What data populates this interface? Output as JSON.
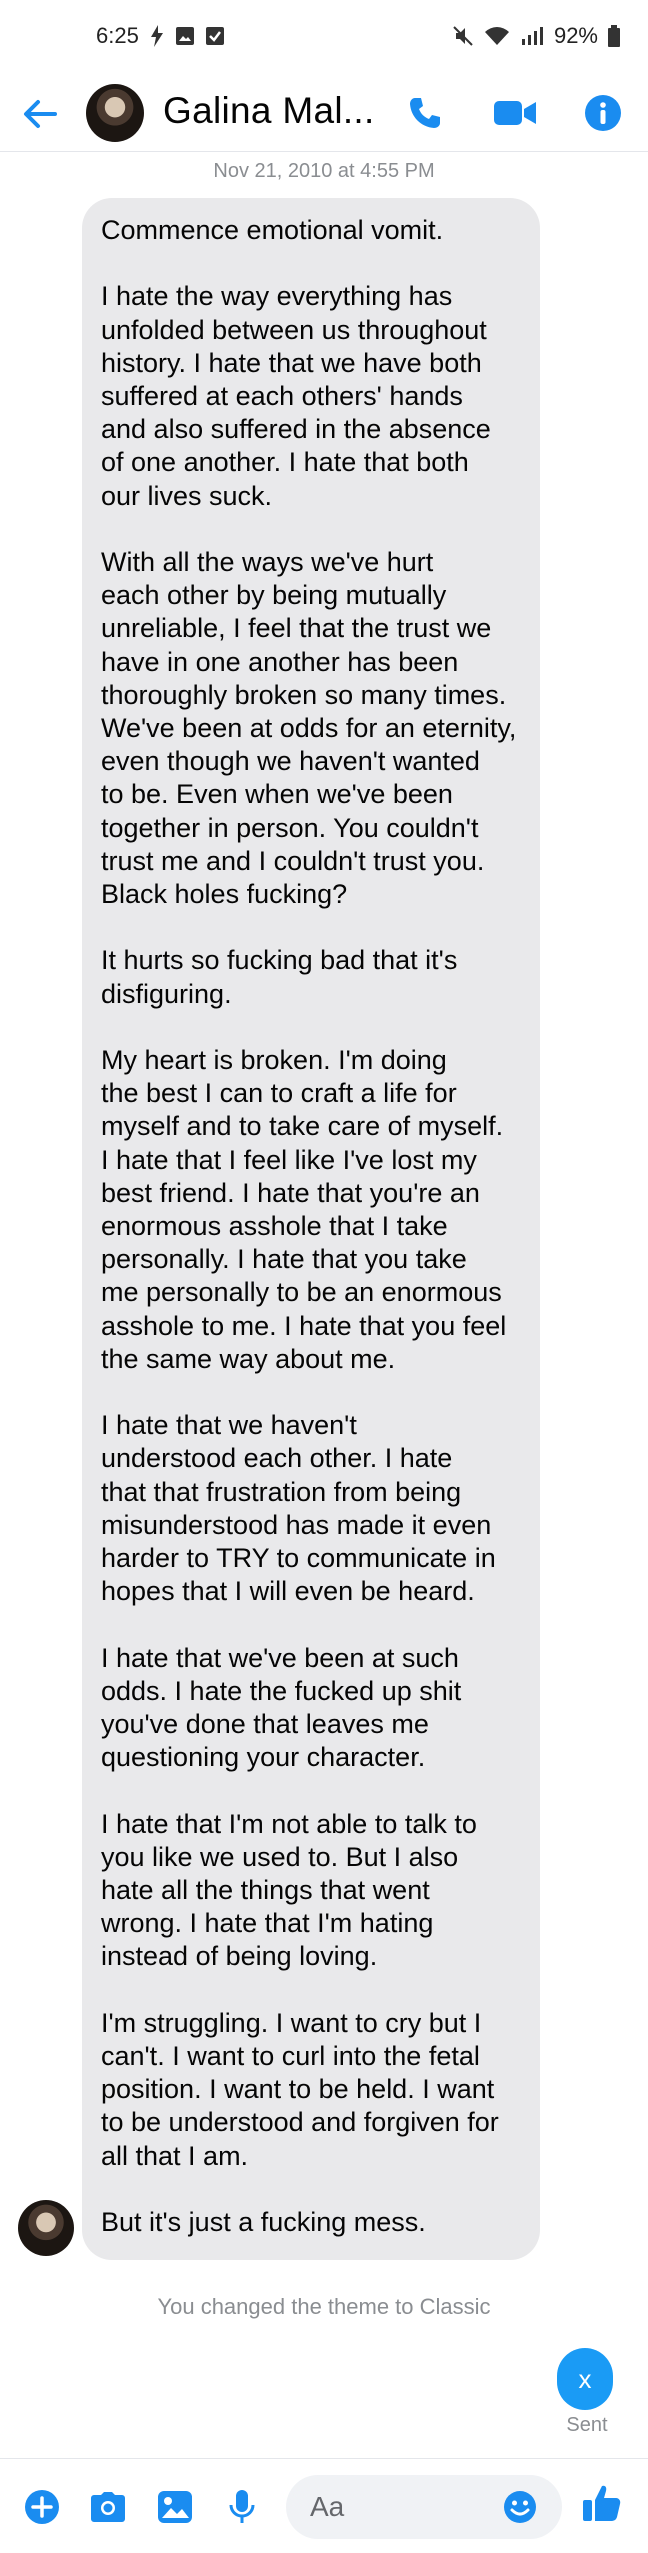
{
  "status_bar": {
    "time": "6:25",
    "battery": "92%"
  },
  "header": {
    "contact_name": "Galina Mal...",
    "icons": [
      "back-arrow-icon",
      "phone-icon",
      "video-camera-icon",
      "info-icon"
    ]
  },
  "conversation": {
    "timestamp": "Nov 21, 2010 at 4:55 PM",
    "message_paragraphs": [
      "Commence emotional vomit.",
      "I hate the way everything has\nunfolded between us throughout\nhistory. I hate that we have both\nsuffered at each others' hands\nand also suffered in the absence\nof one another. I hate that both\nour lives suck.",
      "With all the ways we've hurt\neach other by being mutually\nunreliable, I feel that the trust we\nhave in one another has been\nthoroughly broken so many times.\nWe've been at odds for an eternity,\neven though we haven't wanted\nto be. Even when we've been\ntogether in person. You couldn't\ntrust me and I couldn't trust you.\nBlack holes fucking?",
      "It hurts so fucking bad that it's\ndisfiguring.",
      "My heart is broken. I'm doing\nthe best I can to craft a life for\nmyself and to take care of myself.\nI hate that I feel like I've lost my\nbest friend. I hate that you're an\nenormous asshole that I take\npersonally. I hate that you take\nme personally to be an enormous\nasshole to me. I hate that you feel\nthe same way about me.",
      "I hate that we haven't\nunderstood each other. I hate\nthat that frustration from being\nmisunderstood has made it even\nharder to TRY to communicate in\nhopes that I will even be heard.",
      "I hate that we've been at such\nodds. I hate the fucked up shit\nyou've done that leaves me\nquestioning your character.",
      "I hate that I'm not able to talk to\nyou like we used to. But I also\nhate all the things that went\nwrong. I hate that I'm hating\ninstead of being loving.",
      "I'm struggling. I want to cry but I\ncan't. I want to curl into the fetal\nposition. I want to be held. I want\nto be understood and forgiven for\nall that I am.",
      "But it's just a fucking mess."
    ],
    "system_note": "You changed the theme to Classic",
    "sent_message": "x",
    "sent_status": "Sent"
  },
  "composer": {
    "placeholder": "Aa",
    "icons": [
      "add-circle-icon",
      "camera-icon",
      "gallery-icon",
      "microphone-icon",
      "emoji-icon",
      "thumbs-up-icon"
    ]
  },
  "colors": {
    "accent": "#1a8cf0",
    "bubble_gray": "#e9e9eb",
    "sent_bubble": "#1a9bf5",
    "muted_text": "#8a8d91"
  }
}
